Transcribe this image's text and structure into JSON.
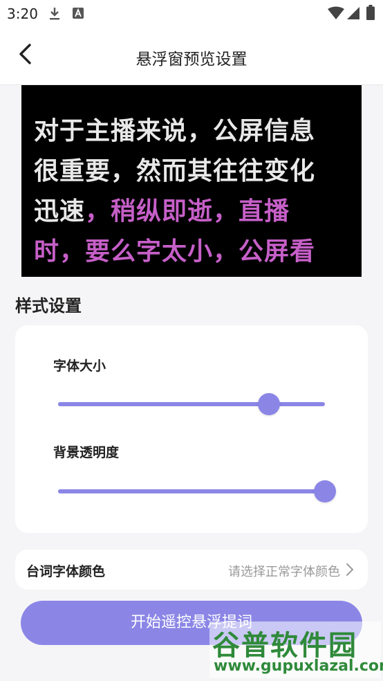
{
  "status_bar": {
    "time": "3:20",
    "left_icons": [
      "download-icon",
      "a-box-icon"
    ],
    "right_icons": [
      "wifi-icon",
      "signal-icon",
      "battery-icon"
    ]
  },
  "header": {
    "title": "悬浮窗预览设置",
    "back_icon": "back-arrow-icon"
  },
  "preview": {
    "line1": "对于主播来说，公屏信息",
    "line2": "很重要，然而其往往变化",
    "line3_normal": "迅速",
    "line3_highlight": "，稍纵即逝，直播",
    "line4_highlight": "时，要么字太小，公屏看",
    "text_color": "#e8e8e8",
    "highlight_color": "#c65fc8",
    "background_color": "#000000"
  },
  "style_section": {
    "title": "样式设置",
    "font_size": {
      "label": "字体大小",
      "value_fraction": 0.79
    },
    "bg_opacity": {
      "label": "背景透明度",
      "value_fraction": 1.0
    }
  },
  "color_row": {
    "label": "台词字体颜色",
    "value": "请选择正常字体颜色",
    "icon": "chevron-right-icon"
  },
  "start_button": {
    "label": "开始遥控悬浮提词"
  },
  "watermark": {
    "title": "谷普软件园",
    "url": "www.gupuxlazal.com"
  },
  "colors": {
    "accent": "#8b86e6",
    "page_bg": "#f5f5f7",
    "card_bg": "#ffffff"
  }
}
